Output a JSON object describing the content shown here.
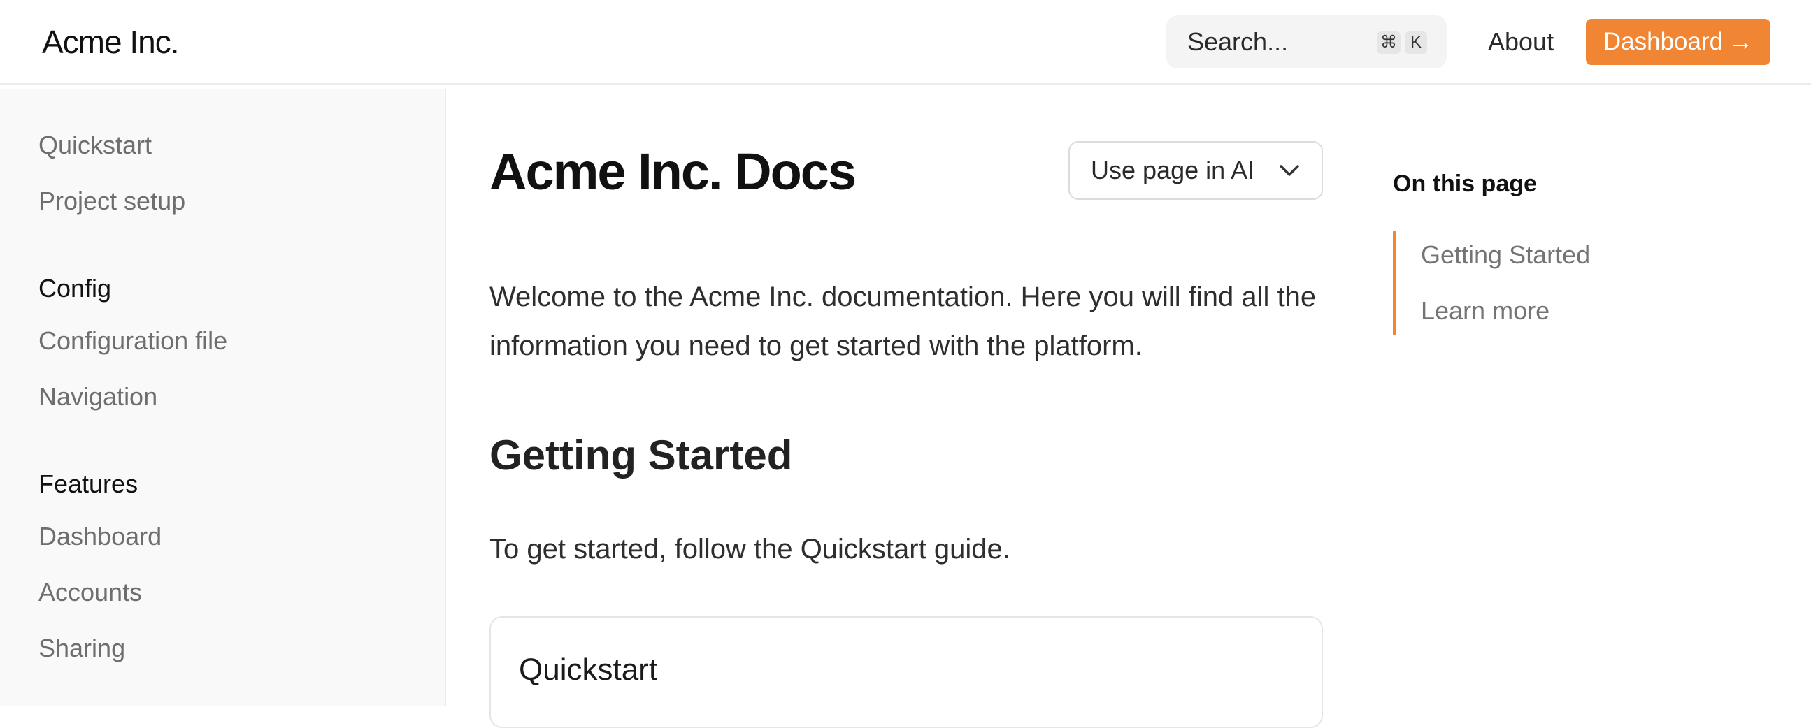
{
  "header": {
    "logo": "Acme Inc.",
    "search": {
      "placeholder": "Search...",
      "shortcut_modifier": "⌘",
      "shortcut_key": "K"
    },
    "about_label": "About",
    "dashboard_label": "Dashboard",
    "dashboard_arrow": "→",
    "accent_color": "#f08634"
  },
  "sidebar": {
    "items_top": [
      {
        "label": "Quickstart"
      },
      {
        "label": "Project setup"
      }
    ],
    "groups": [
      {
        "heading": "Config",
        "items": [
          {
            "label": "Configuration file"
          },
          {
            "label": "Navigation"
          }
        ]
      },
      {
        "heading": "Features",
        "items": [
          {
            "label": "Dashboard"
          },
          {
            "label": "Accounts"
          },
          {
            "label": "Sharing"
          }
        ]
      }
    ]
  },
  "main": {
    "title": "Acme Inc. Docs",
    "ai_button_label": "Use page in AI",
    "ai_button_icon": "chevron-down-icon",
    "intro": "Welcome to the Acme Inc. documentation. Here you will find all the information you need to get started with the platform.",
    "section_heading": "Getting Started",
    "section_text": "To get started, follow the Quickstart guide.",
    "card_title": "Quickstart"
  },
  "toc": {
    "title": "On this page",
    "items": [
      {
        "label": "Getting Started"
      },
      {
        "label": "Learn more"
      }
    ]
  }
}
